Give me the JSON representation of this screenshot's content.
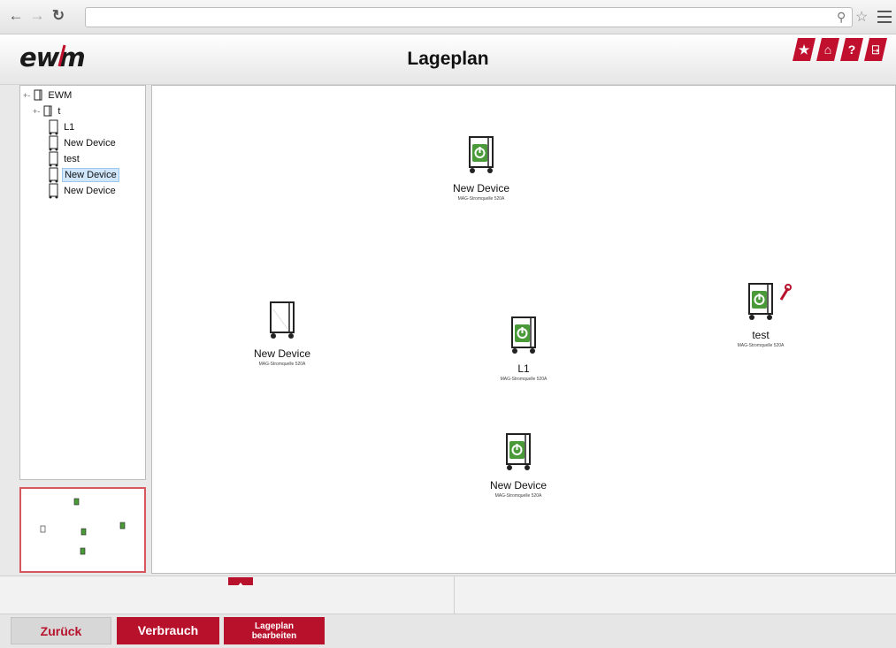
{
  "browser": {
    "back_icon": "arrow-left-icon",
    "forward_icon": "arrow-right-icon",
    "reload_icon": "reload-icon",
    "url": ""
  },
  "header": {
    "logo": "ewm",
    "title": "Lageplan",
    "buttons": [
      "star-icon",
      "home-icon",
      "help-icon",
      "exit-icon"
    ],
    "accent": "#c0102d"
  },
  "tree": {
    "root": "EWM",
    "group": "t",
    "items": [
      {
        "label": "L1",
        "selected": false
      },
      {
        "label": "New Device",
        "selected": false
      },
      {
        "label": "test",
        "selected": false
      },
      {
        "label": "New Device",
        "selected": true
      },
      {
        "label": "New Device",
        "selected": false
      }
    ]
  },
  "canvas": {
    "devices": [
      {
        "name": "New Device",
        "type": "MAG-Stromquelle 520A",
        "status": "on"
      },
      {
        "name": "New Device",
        "type": "MAG-Stromquelle 520A",
        "status": "off"
      },
      {
        "name": "L1",
        "type": "MAG-Stromquelle 520A",
        "status": "on"
      },
      {
        "name": "test",
        "type": "MAG-Stromquelle 520A",
        "status": "on-service"
      },
      {
        "name": "New Device",
        "type": "MAG-Stromquelle 520A",
        "status": "on"
      }
    ]
  },
  "footer": {
    "back_label": "Zurück",
    "consumption_label": "Verbrauch",
    "edit_label_line1": "Lageplan",
    "edit_label_line2": "bearbeiten"
  }
}
